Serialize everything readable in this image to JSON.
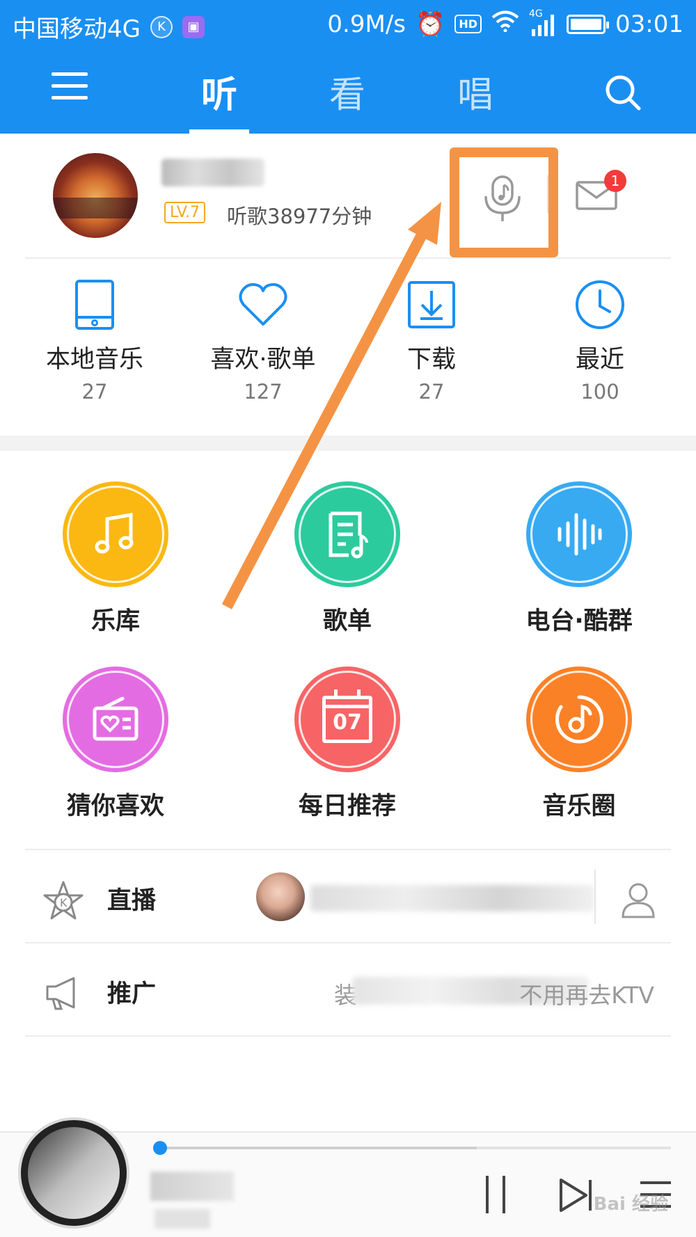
{
  "status_bar": {
    "carrier": "中国移动4G",
    "network_speed": "0.9M/s",
    "hd_badge": "HD",
    "signal_type": "4G",
    "time": "03:01"
  },
  "nav": {
    "tabs": [
      {
        "label": "听",
        "active": true
      },
      {
        "label": "看",
        "active": false
      },
      {
        "label": "唱",
        "active": false
      }
    ]
  },
  "profile": {
    "level": "LV.7",
    "listening_time": "听歌38977分钟",
    "message_count": "1"
  },
  "quick_access": [
    {
      "label": "本地音乐",
      "count": "27",
      "icon": "tablet-icon"
    },
    {
      "label": "喜欢·歌单",
      "count": "127",
      "icon": "heart-icon"
    },
    {
      "label": "下载",
      "count": "27",
      "icon": "download-icon"
    },
    {
      "label": "最近",
      "count": "100",
      "icon": "clock-icon"
    }
  ],
  "features": [
    {
      "label": "乐库",
      "color": "#fbb813",
      "icon": "music-note-icon"
    },
    {
      "label": "歌单",
      "color": "#2ccb9e",
      "icon": "playlist-icon"
    },
    {
      "label": "电台·酷群",
      "color": "#37aaf2",
      "icon": "sound-wave-icon"
    },
    {
      "label": "猜你喜欢",
      "color": "#e46ce2",
      "icon": "radio-heart-icon"
    },
    {
      "label": "每日推荐",
      "color": "#f76466",
      "icon": "calendar-icon",
      "date": "07"
    },
    {
      "label": "音乐圈",
      "color": "#fb8127",
      "icon": "music-disc-icon"
    }
  ],
  "rows": {
    "live": {
      "label": "直播"
    },
    "promo": {
      "label": "推广",
      "text_start": "装",
      "text_end": "不用再去KTV"
    }
  },
  "player": {
    "progress": 0.62
  },
  "watermark": "Bai 经验",
  "colors": {
    "brand_blue": "#1a8ff2",
    "annotation_orange": "#f59344",
    "badge_red": "#f23b3b",
    "level_orange": "#f5a623"
  }
}
